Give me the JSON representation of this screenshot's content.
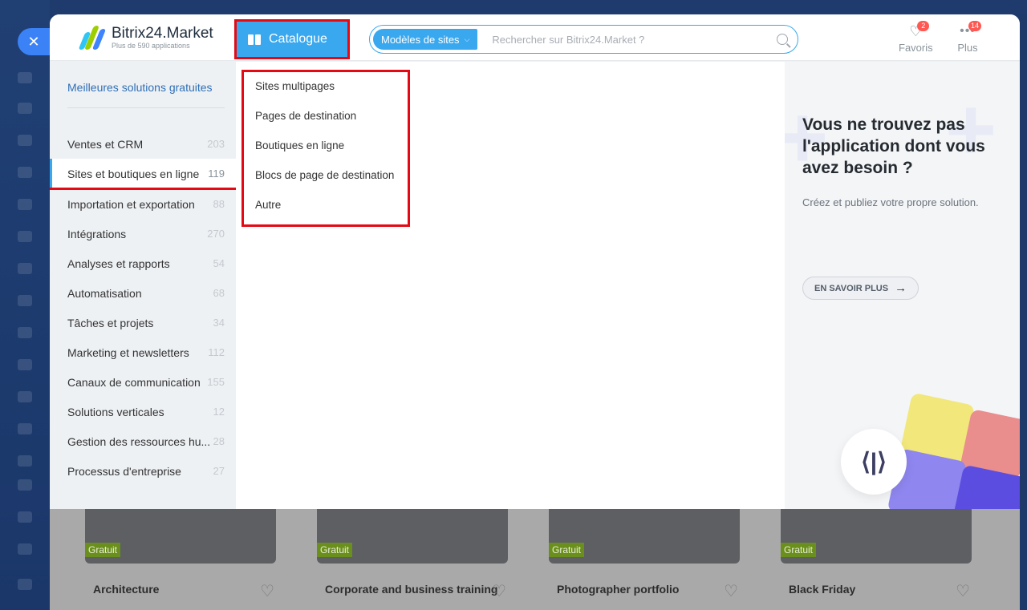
{
  "window": {
    "close_icon": "close-icon"
  },
  "header": {
    "logo_title": "Bitrix24.Market",
    "logo_subtitle": "Plus de 590 applications",
    "catalogue_label": "Catalogue",
    "search_chip": "Modèles de sites",
    "search_placeholder": "Rechercher sur Bitrix24.Market ?",
    "favoris_label": "Favoris",
    "favoris_badge": "2",
    "plus_label": "Plus",
    "plus_badge": "14"
  },
  "categories": {
    "best_label": "Meilleures solutions gratuites",
    "items": [
      {
        "label": "Ventes et CRM",
        "count": "203"
      },
      {
        "label": "Sites et boutiques en ligne",
        "count": "119"
      },
      {
        "label": "Importation et exportation",
        "count": "88"
      },
      {
        "label": "Intégrations",
        "count": "270"
      },
      {
        "label": "Analyses et rapports",
        "count": "54"
      },
      {
        "label": "Automatisation",
        "count": "68"
      },
      {
        "label": "Tâches et projets",
        "count": "34"
      },
      {
        "label": "Marketing et newsletters",
        "count": "112"
      },
      {
        "label": "Canaux de communication",
        "count": "155"
      },
      {
        "label": "Solutions verticales",
        "count": "12"
      },
      {
        "label": "Gestion des ressources hu...",
        "count": "28"
      },
      {
        "label": "Processus d'entreprise",
        "count": "27"
      }
    ],
    "active_index": 1
  },
  "subcategories": [
    "Sites multipages",
    "Pages de destination",
    "Boutiques en ligne",
    "Blocs de page de destination",
    "Autre"
  ],
  "promo": {
    "title": "Vous ne trouvez pas l'application dont vous avez besoin ?",
    "subtitle": "Créez et publiez votre propre solution.",
    "button": "EN SAVOIR PLUS",
    "code_glyph": "⟨|⟩"
  },
  "cards": [
    {
      "name": "Architecture",
      "tag": "Gratuit"
    },
    {
      "name": "Corporate and business training",
      "tag": "Gratuit"
    },
    {
      "name": "Photographer portfolio",
      "tag": "Gratuit"
    },
    {
      "name": "Black Friday",
      "tag": "Gratuit"
    }
  ],
  "colors": {
    "accent": "#39a8ef",
    "highlight": "#e50914",
    "badge": "#ff5752"
  }
}
